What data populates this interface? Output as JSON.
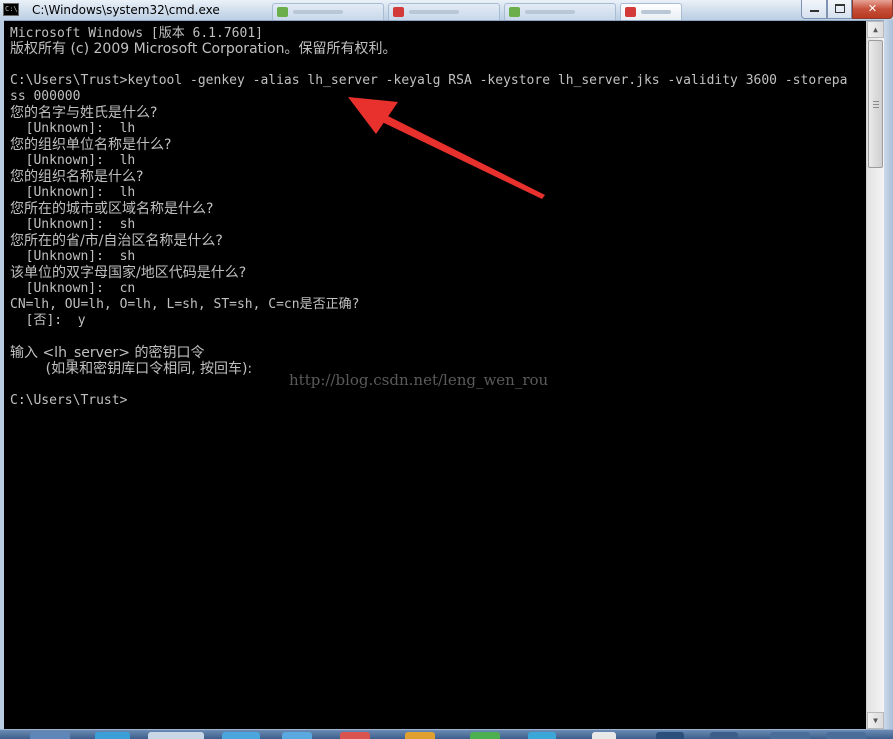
{
  "window": {
    "title": "C:\\Windows\\system32\\cmd.exe",
    "icon": "cmd-icon",
    "controls": {
      "minimize": "minimize-icon",
      "maximize": "maximize-icon",
      "close": "close-icon",
      "close_label": "✕"
    }
  },
  "console": {
    "lines": [
      "Microsoft Windows [版本 6.1.7601]",
      "版权所有 (c) 2009 Microsoft Corporation。保留所有权利。",
      "",
      "C:\\Users\\Trust>keytool -genkey -alias lh_server -keyalg RSA -keystore lh_server.jks -validity 3600 -storepa",
      "ss 000000",
      "您的名字与姓氏是什么?",
      "  [Unknown]:  lh",
      "您的组织单位名称是什么?",
      "  [Unknown]:  lh",
      "您的组织名称是什么?",
      "  [Unknown]:  lh",
      "您所在的城市或区域名称是什么?",
      "  [Unknown]:  sh",
      "您所在的省/市/自治区名称是什么?",
      "  [Unknown]:  sh",
      "该单位的双字母国家/地区代码是什么?",
      "  [Unknown]:  cn",
      "CN=lh, OU=lh, O=lh, L=sh, ST=sh, C=cn是否正确?",
      "  [否]:  y",
      "",
      "输入 <lh_server> 的密钥口令",
      "        (如果和密钥库口令相同, 按回车):",
      "",
      "C:\\Users\\Trust>"
    ],
    "watermark": "http://blog.csdn.net/leng_wen_rou"
  },
  "annotation": {
    "arrow_color": "#e8312d",
    "arrow_icon": "red-arrow-annotation"
  },
  "scrollbar": {
    "up_icon": "scroll-up-icon",
    "down_icon": "scroll-down-icon",
    "up_glyph": "▲",
    "down_glyph": "▼"
  },
  "colors": {
    "console_bg": "#000000",
    "console_text": "#c0c0c0"
  }
}
